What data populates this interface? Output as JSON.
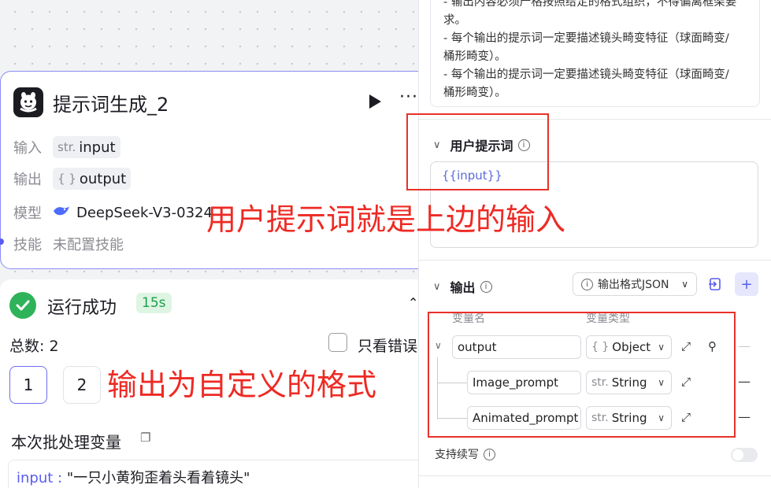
{
  "node": {
    "title": "提示词生成_2",
    "input_label": "输入",
    "input_type": "str.",
    "input_value": "input",
    "output_label": "输出",
    "output_type": "{ }",
    "output_value": "output",
    "model_label": "模型",
    "model_value": "DeepSeek-V3-0324",
    "skill_label": "技能",
    "skill_value": "未配置技能"
  },
  "run": {
    "status": "运行成功",
    "duration": "15s",
    "total": "总数: 2",
    "only_errors": "只看错误",
    "pages": [
      "1",
      "2"
    ],
    "batch_title": "本次批处理变量",
    "batch_key": "input :",
    "batch_value": "\"一只小黄狗歪着头看着镜头\""
  },
  "annotations": {
    "user_prompt_note": "用户提示词就是上边的输入",
    "output_note": "输出为自定义的格式"
  },
  "panel": {
    "system_lines": [
      "- 输出内容必须严格按照给定的格式组织，不得偏离框架要",
      "求。",
      "- 每个输出的提示词一定要描述镜头畸变特征（球面畸变/",
      "桶形畸变）。",
      "- 每个输出的提示词一定要描述镜头畸变特征（球面畸变/",
      "桶形畸变）。"
    ],
    "user_prompt_title": "用户提示词",
    "user_prompt_value": "{{input}}",
    "output_title": "输出",
    "output_format": "输出格式JSON",
    "col_name": "变量名",
    "col_type": "变量类型",
    "fields": [
      {
        "name": "output",
        "type_prefix": "{ }",
        "type": "Object"
      },
      {
        "name": "Image_prompt",
        "type_prefix": "str.",
        "type": "String"
      },
      {
        "name": "Animated_prompt",
        "type_prefix": "str.",
        "type": "String"
      }
    ],
    "stream_label": "支持续写"
  },
  "colors": {
    "accent": "#5a5cf0",
    "success": "#2fb35a",
    "annotation": "#ee2a24"
  }
}
